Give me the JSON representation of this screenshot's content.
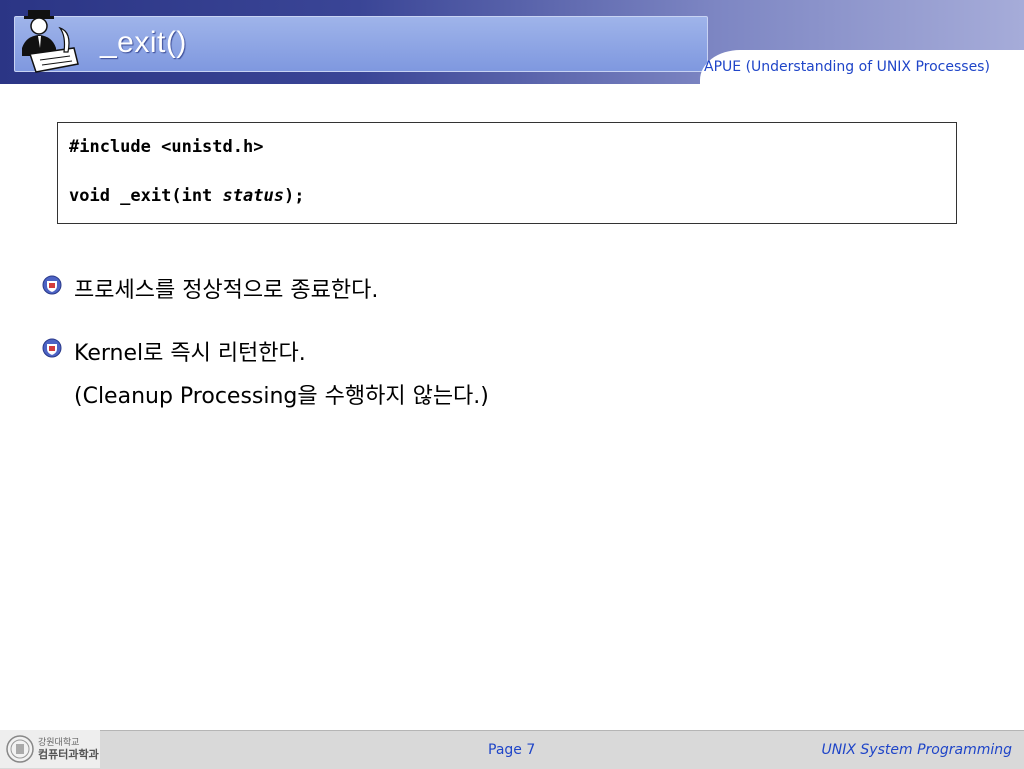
{
  "header": {
    "title": "_exit()",
    "subtitle": "APUE (Understanding of UNIX Processes)"
  },
  "code": {
    "line1": "#include <unistd.h>",
    "line2_prefix": "void _exit(int ",
    "line2_param": "status",
    "line2_suffix": ");"
  },
  "bullets": [
    {
      "text": "프로세스를 정상적으로 종료한다."
    },
    {
      "text": "Kernel로 즉시 리턴한다."
    }
  ],
  "bullet2_continuation": "(Cleanup Processing을 수행하지 않는다.)",
  "footer": {
    "university_line1": "강원대학교",
    "university_line2": "컴퓨터과학과",
    "page": "Page 7",
    "course": "UNIX System Programming"
  },
  "colors": {
    "accent": "#1f45c8",
    "header_dark": "#2b3585",
    "title_bar": "#8fa6e4"
  }
}
